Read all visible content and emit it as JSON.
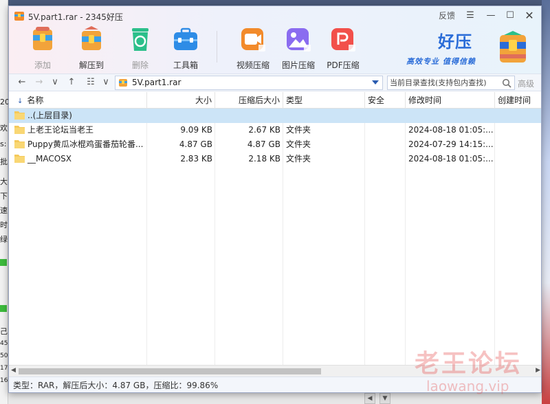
{
  "window": {
    "title": "5V.part1.rar - 2345好压",
    "feedback_label": "反馈"
  },
  "toolbar": [
    {
      "id": "add",
      "label": "添加",
      "disabled": true,
      "color": "#3aa0e8"
    },
    {
      "id": "extract",
      "label": "解压到",
      "disabled": false,
      "color": "#3aa0e8"
    },
    {
      "id": "delete",
      "label": "删除",
      "disabled": true,
      "color": "#2bbf8a"
    },
    {
      "id": "toolbox",
      "label": "工具箱",
      "disabled": false,
      "color": "#2e8ce6"
    },
    {
      "id": "video",
      "label": "视频压缩",
      "disabled": false,
      "color": "#f28a2a"
    },
    {
      "id": "image",
      "label": "图片压缩",
      "disabled": false,
      "color": "#8a6cf0"
    },
    {
      "id": "pdf",
      "label": "PDF压缩",
      "disabled": false,
      "color": "#f2504a"
    }
  ],
  "brand": {
    "name": "好压",
    "slogan": "高效专业 值得信赖"
  },
  "address": {
    "path": "5V.part1.rar",
    "search_placeholder": "当前目录查找(支持包内查找)",
    "advanced_label": "高级"
  },
  "columns": [
    {
      "id": "name",
      "label": "名称"
    },
    {
      "id": "size",
      "label": "大小"
    },
    {
      "id": "packed",
      "label": "压缩后大小"
    },
    {
      "id": "type",
      "label": "类型"
    },
    {
      "id": "security",
      "label": "安全"
    },
    {
      "id": "modified",
      "label": "修改时间"
    },
    {
      "id": "created",
      "label": "创建时间"
    }
  ],
  "rows": [
    {
      "name": "..(上层目录)",
      "size": "",
      "packed": "",
      "type": "",
      "security": "",
      "modified": "",
      "created": "",
      "selected": true
    },
    {
      "name": "上老王论坛当老王",
      "size": "9.09 KB",
      "packed": "2.67 KB",
      "type": "文件夹",
      "security": "",
      "modified": "2024-08-18 01:05:...",
      "created": "",
      "selected": false
    },
    {
      "name": "Puppy黄瓜冰棍鸡蛋番茄轮番...",
      "size": "4.87 GB",
      "packed": "4.87 GB",
      "type": "文件夹",
      "security": "",
      "modified": "2024-07-29 14:15:...",
      "created": "",
      "selected": false
    },
    {
      "name": "__MACOSX",
      "size": "2.83 KB",
      "packed": "2.18 KB",
      "type": "文件夹",
      "security": "",
      "modified": "2024-08-18 01:05:...",
      "created": "",
      "selected": false
    }
  ],
  "status": {
    "text": "类型：RAR，解压后大小：4.87 GB，压缩比：99.86%"
  },
  "watermark": {
    "line1": "老王论坛",
    "line2": "laowang.vip"
  },
  "background": {
    "left_fragments": [
      "20",
      "欢",
      "s:",
      "批",
      "大",
      "下",
      "速",
      "时",
      "绿",
      "己",
      "45",
      "50",
      "17",
      "16"
    ]
  }
}
